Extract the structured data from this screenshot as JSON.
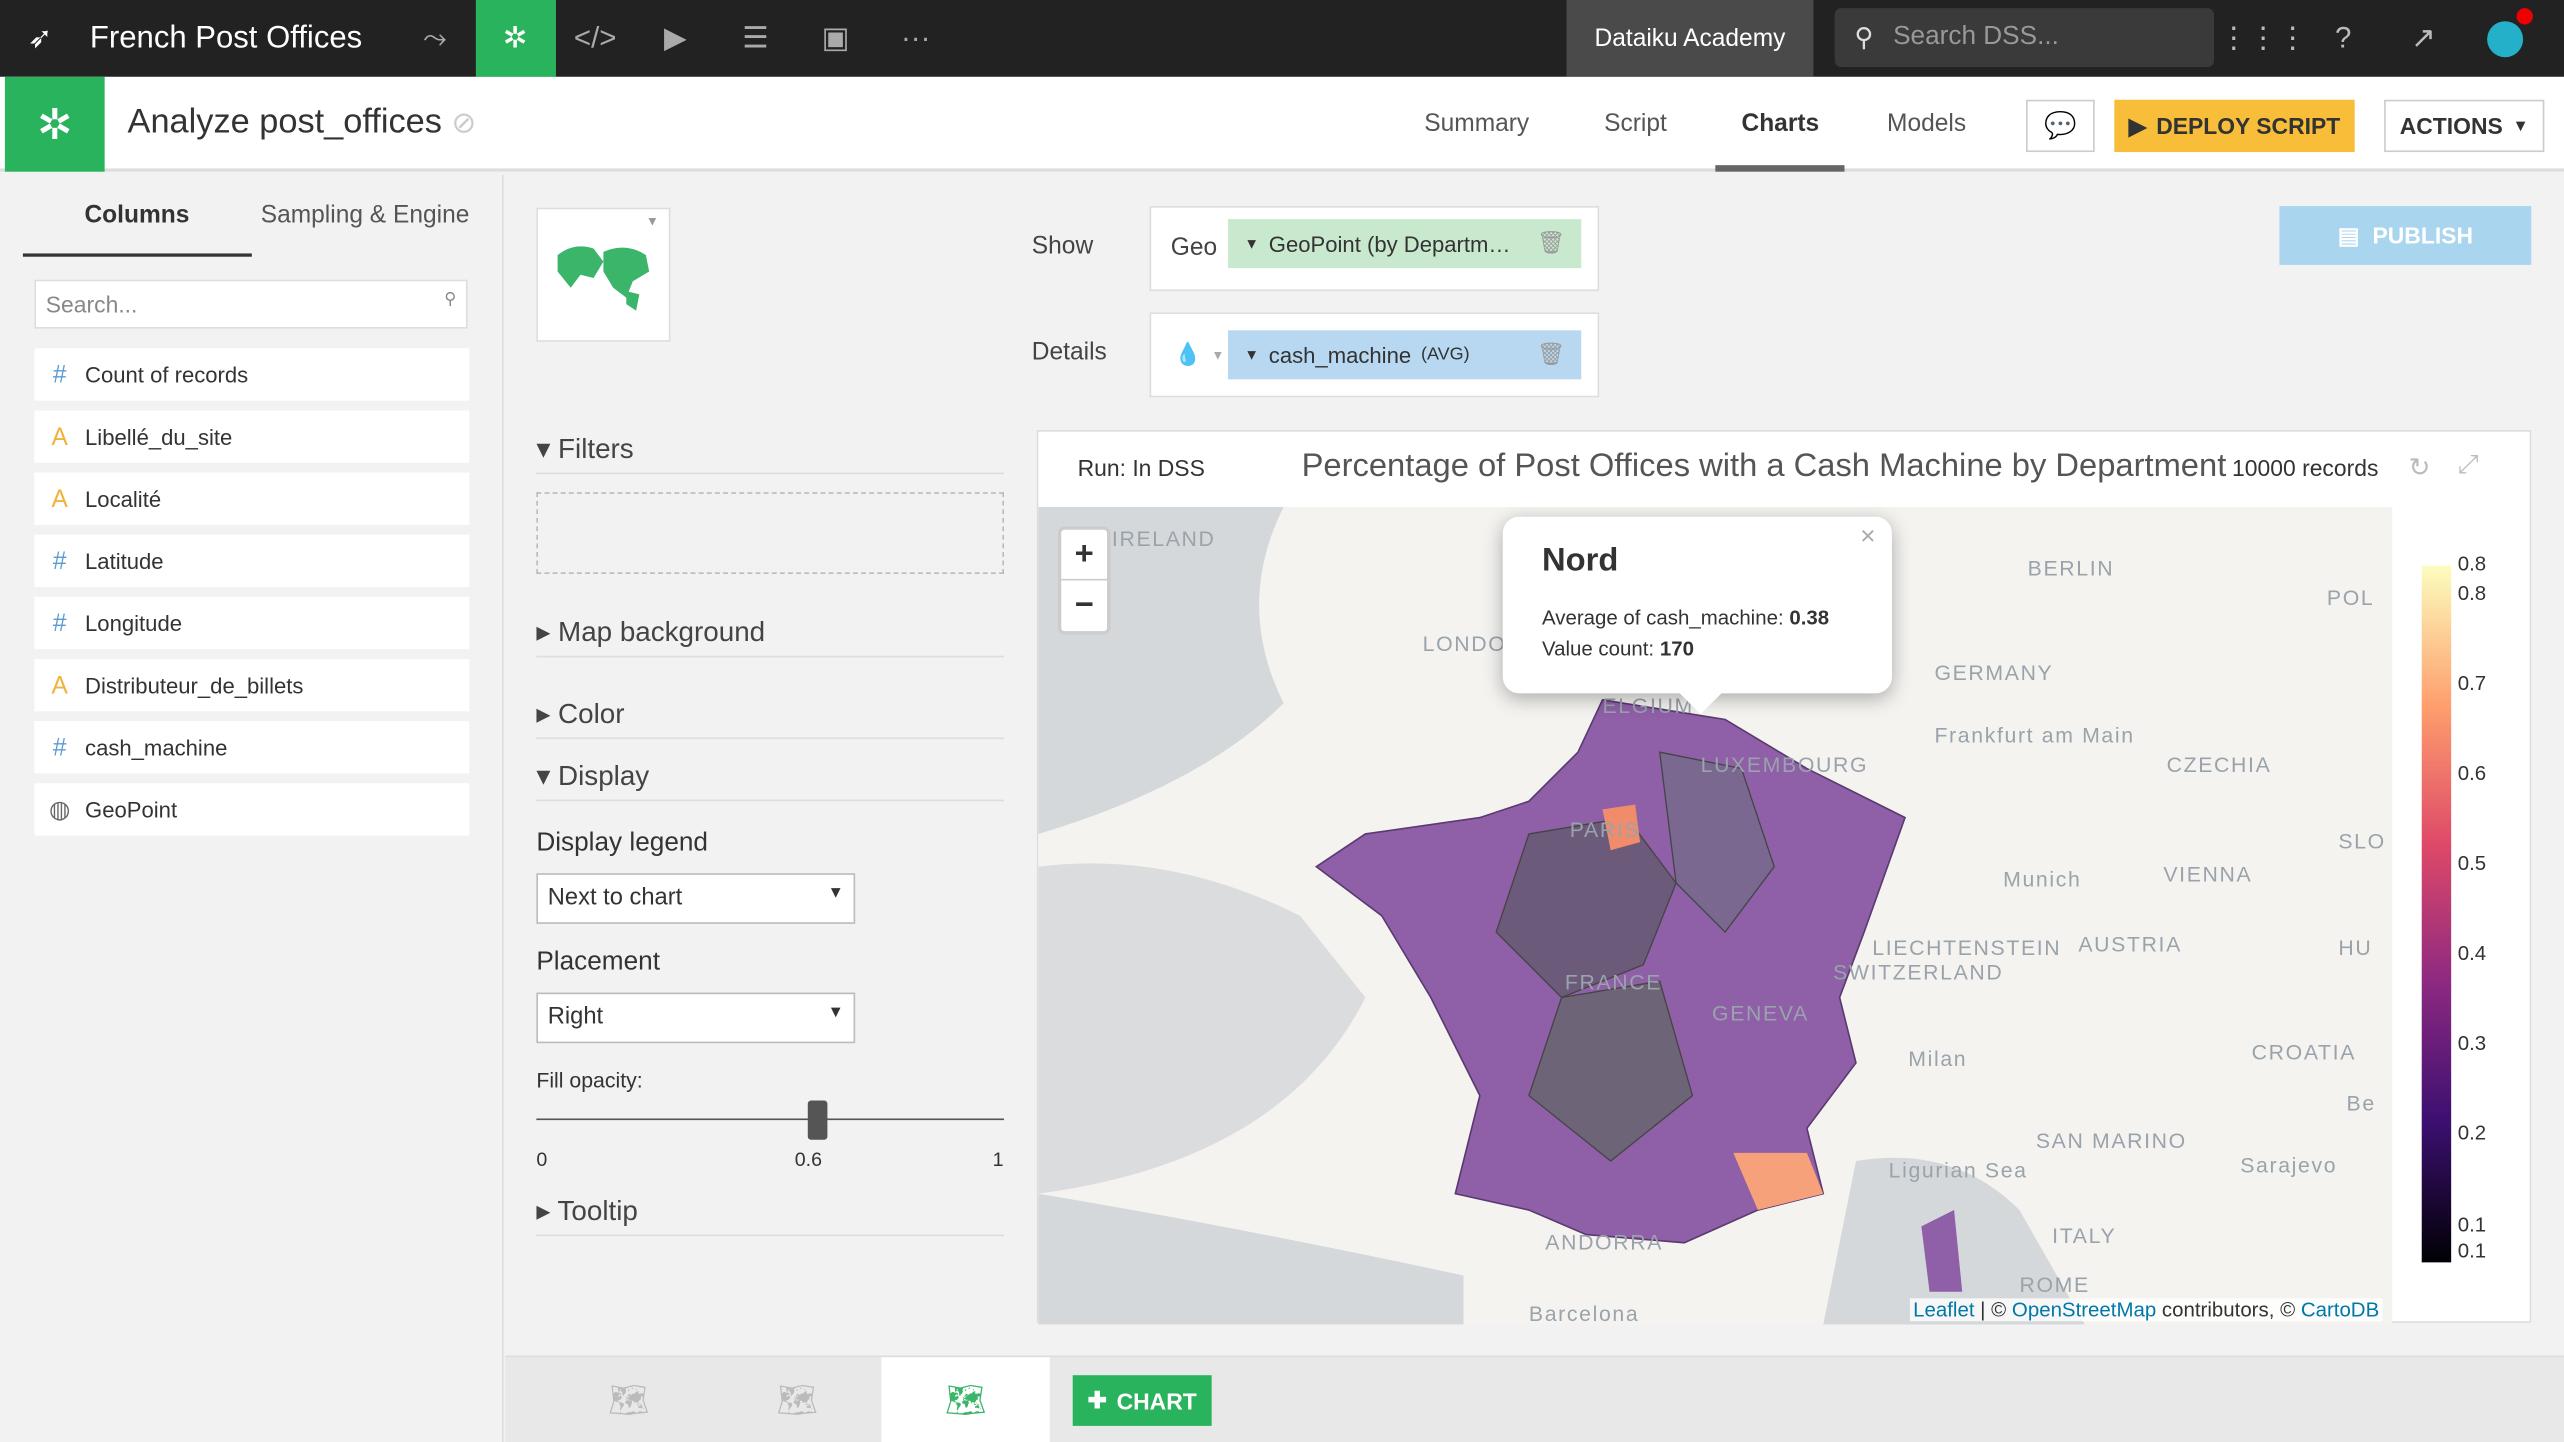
{
  "topbar": {
    "project": "French Post Offices",
    "academy": "Dataiku Academy",
    "search_placeholder": "Search DSS...",
    "icons": [
      "bird-logo-icon",
      "flow-icon",
      "analysis-icon",
      "code-icon",
      "run-icon",
      "stack-icon",
      "dashboard-icon",
      "more-icon",
      "apps-grid-icon",
      "help-icon",
      "activity-icon",
      "avatar"
    ]
  },
  "subbar": {
    "title": "Analyze post_offices",
    "nav": [
      "Summary",
      "Script",
      "Charts",
      "Models"
    ],
    "active_nav": "Charts",
    "deploy": "DEPLOY SCRIPT",
    "actions": "ACTIONS"
  },
  "left": {
    "tabs": [
      "Columns",
      "Sampling & Engine"
    ],
    "search_placeholder": "Search...",
    "columns": [
      {
        "type": "#",
        "name": "Count of records"
      },
      {
        "type": "A",
        "name": "Libellé_du_site"
      },
      {
        "type": "A",
        "name": "Localité"
      },
      {
        "type": "#",
        "name": "Latitude"
      },
      {
        "type": "#",
        "name": "Longitude"
      },
      {
        "type": "A",
        "name": "Distributeur_de_billets"
      },
      {
        "type": "#",
        "name": "cash_machine"
      },
      {
        "type": "geo",
        "name": "GeoPoint"
      }
    ]
  },
  "options": {
    "filters": "Filters",
    "map_background": "Map background",
    "color": "Color",
    "display": "Display",
    "display_legend_label": "Display legend",
    "display_legend_value": "Next to chart",
    "placement_label": "Placement",
    "placement_value": "Right",
    "fill_opacity_label": "Fill opacity:",
    "fill_opacity": 0.6,
    "slider_min": "0",
    "slider_mid": "0.6",
    "slider_max": "1",
    "tooltip": "Tooltip"
  },
  "config": {
    "show_label": "Show",
    "geo_label": "Geo",
    "geo_value": "GeoPoint (by Departm…",
    "details_label": "Details",
    "details_value": "cash_machine",
    "details_agg": "(AVG)",
    "publish": "PUBLISH"
  },
  "chart": {
    "run": "Run: In DSS",
    "title": "Percentage of Post Offices with a Cash Machine by Department",
    "records": "10000 records",
    "popup": {
      "name": "Nord",
      "avg_label": "Average of cash_machine:",
      "avg_value": "0.38",
      "count_label": "Value count:",
      "count_value": "170"
    },
    "map_labels": [
      "IRELAND",
      "LONDO",
      "BERLIN",
      "GERMANY",
      "ELGIUM",
      "LUXEMBOURG",
      "Frankfurt am Main",
      "CZECHIA",
      "POL",
      "PARIS",
      "FRANCE",
      "Munich",
      "VIENNA",
      "SLO",
      "LIECHTENSTEIN",
      "AUSTRIA",
      "SWITZERLAND",
      "GENEVA",
      "Milan",
      "CROATIA",
      "HU",
      "Be",
      "SAN MARINO",
      "Sarajevo",
      "Ligurian Sea",
      "ITALY",
      "ANDORRA",
      "ROME",
      "Barcelona"
    ],
    "attribution": {
      "leaflet": "Leaflet",
      "sep": " | © ",
      "osm": "OpenStreetMap",
      "mid": " contributors, © ",
      "carto": "CartoDB"
    },
    "legend_ticks": [
      "0.8",
      "0.8",
      "0.7",
      "0.6",
      "0.5",
      "0.4",
      "0.3",
      "0.2",
      "0.1",
      "0.1"
    ],
    "colors": {
      "low": "#000004",
      "high": "#fcfdbf",
      "region": "#8f5fa8"
    }
  },
  "bottom": {
    "add_chart": "CHART"
  }
}
